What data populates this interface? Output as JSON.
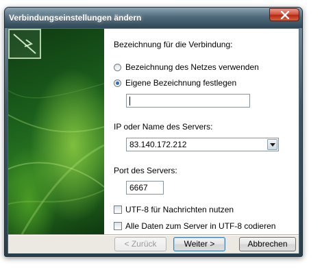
{
  "window": {
    "title": "Verbindungseinstellungen ändern"
  },
  "form": {
    "name_label": "Bezeichnung für die Verbindung:",
    "radio_network_name": "Bezeichnung des Netzes verwenden",
    "radio_custom_name": "Eigene Bezeichnung festlegen",
    "selected_radio": "custom",
    "custom_name_value": "",
    "server_label": "IP oder Name des Servers:",
    "server_value": "83.140.172.212",
    "port_label": "Port des Servers:",
    "port_value": "6667",
    "checkbox_utf8_messages": "UTF-8 für Nachrichten nutzen",
    "checkbox_utf8_all": "Alle Daten zum Server in UTF-8 codieren",
    "checkbox_utf8_messages_checked": false,
    "checkbox_utf8_all_checked": false
  },
  "buttons": {
    "back": "< Zurück",
    "next": "Weiter >",
    "cancel": "Abbrechen"
  },
  "icons": {
    "close": "close-icon",
    "banner_logo": "network-connection-icon"
  },
  "colors": {
    "banner_dark": "#0f3a12",
    "banner_light": "#7fbf3e",
    "close_red": "#c8402a",
    "radio_dot": "#2a6fb8"
  }
}
